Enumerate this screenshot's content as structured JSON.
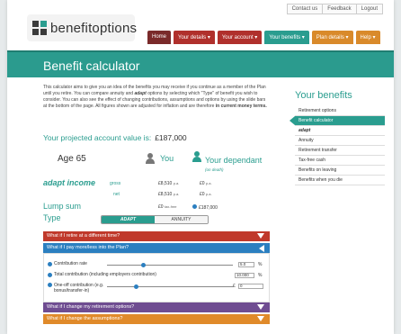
{
  "header": {
    "logo_text": "benefitoptions",
    "utility_links": [
      "Contact us",
      "Feedback",
      "Logout"
    ],
    "nav": [
      {
        "label": "Home",
        "style": "home"
      },
      {
        "label": "Your details ▾",
        "style": "red"
      },
      {
        "label": "Your account ▾",
        "style": "red"
      },
      {
        "label": "Your benefits ▾",
        "style": "active"
      },
      {
        "label": "Plan details ▾",
        "style": "orange"
      },
      {
        "label": "Help ▾",
        "style": "orange"
      }
    ]
  },
  "page_title": "Benefit calculator",
  "intro": {
    "part1": "This calculator aims to give you an idea of the benefits you may receive if you continue as a member of the Plan until you retire. You can compare annuity and ",
    "adapt_word": "adapt",
    "part2": " options by selecting which \"Type\" of benefit you wish to consider. You can also see the effect of changing contributions, assumptions and options by using the slide bars at the bottom of the page. All figures shown are adjusted for inflation and are therefore ",
    "bold_end": "in current money terms."
  },
  "projected": {
    "label": "Your projected account value is:",
    "amount": "£187,000"
  },
  "age_label": "Age 65",
  "you_label": "You",
  "dependant_label": "Your dependant",
  "dependant_sub": "(on death)",
  "adapt_income_label": "adapt income",
  "gross_label": "gross",
  "net_label": "net",
  "you_gross": "£8,510",
  "you_net": "£8,510",
  "dep_gross": "£0",
  "dep_net": "£0",
  "pa": "p.a.",
  "lump_sum_label": "Lump sum",
  "lump_you": "£0",
  "lump_you_note": "tax-free",
  "lump_dep": "£187,000",
  "type_label": "Type",
  "type_options": [
    "ADAPT",
    "ANNUITY"
  ],
  "accordion": {
    "retire": "What if I retire at a different time?",
    "paymore": "What if I pay more/less into the Plan?",
    "change_options": "What if I change my retirement options?",
    "change_assumptions": "What if I change the assumptions?"
  },
  "contrib": {
    "rate_label": "Contribution rate",
    "rate_value": "5.0",
    "total_label": "Total contribution (including employers contribution)",
    "total_value": "10.000",
    "oneoff_label": "One-off contribution (e.g. bonus/transfer-in)",
    "oneoff_value": "0",
    "pct": "%",
    "pound": "£"
  },
  "sidebar": {
    "title": "Your benefits",
    "items": [
      "Retirement options",
      "Benefit calculator",
      "adapt",
      "Annuity",
      "Retirement transfer",
      "Tax-free cash",
      "Benefits on leaving",
      "Benefits when you die"
    ]
  }
}
